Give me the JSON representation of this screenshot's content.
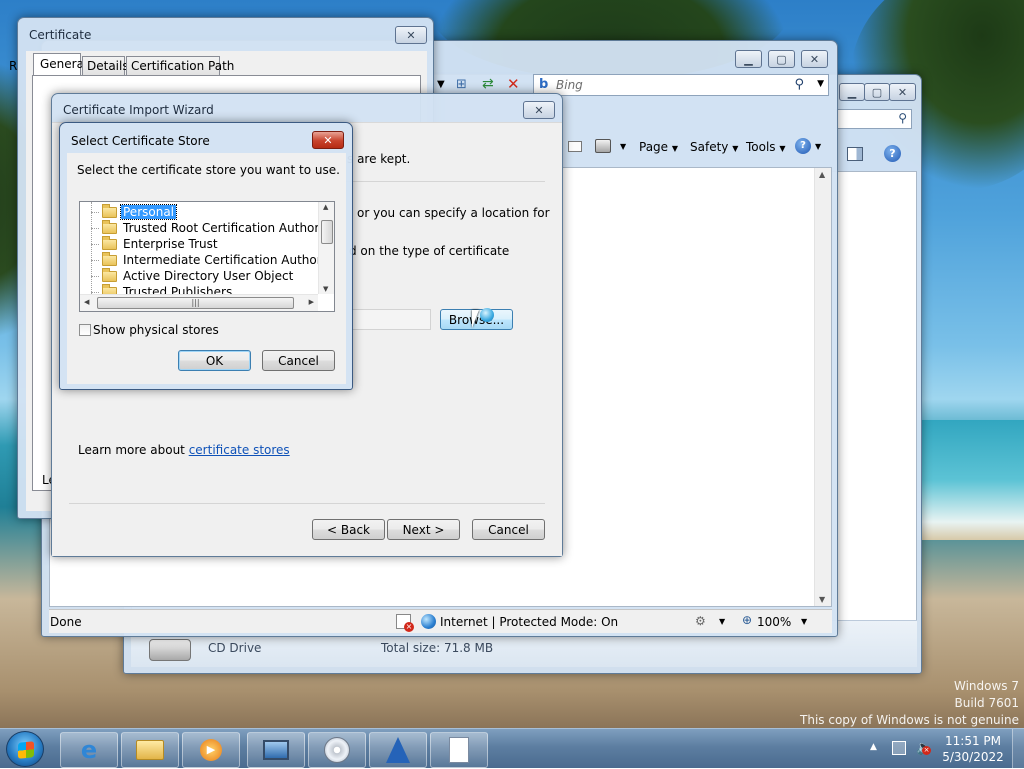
{
  "certificate_window": {
    "title": "Certificate",
    "tabs": [
      "General",
      "Details",
      "Certification Path"
    ],
    "left_fragment_r": "R",
    "left_fragment_le": "Le"
  },
  "ie_window": {
    "search_placeholder": "Bing",
    "toolbar": {
      "page": "Page",
      "safety": "Safety",
      "tools": "Tools"
    },
    "status": {
      "done": "Done",
      "zone": "Internet | Protected Mode: On",
      "zoom": "100%"
    }
  },
  "explorer_window": {
    "drive_name": "CD Drive",
    "total_size": "Total size: 71.8 MB"
  },
  "wizard": {
    "title": "Certificate Import Wizard",
    "line1": "s are kept.",
    "line2": "or you can specify a location for",
    "line3": "d on the type of certificate",
    "browse_label": "Browse...",
    "learn_more": "Learn more about ",
    "learn_more_link": "certificate stores",
    "back_label": "< Back",
    "next_label": "Next >",
    "cancel_label": "Cancel"
  },
  "store_dialog": {
    "title": "Select Certificate Store",
    "prompt": "Select the certificate store you want to use.",
    "stores": [
      "Personal",
      "Trusted Root Certification Authorities",
      "Enterprise Trust",
      "Intermediate Certification Authorities",
      "Active Directory User Object",
      "Trusted Publishers"
    ],
    "selected_index": 0,
    "show_physical": "Show physical stores",
    "ok_label": "OK",
    "cancel_label": "Cancel"
  },
  "watermark": {
    "line1": "Windows 7",
    "line2": "Build 7601",
    "line3": "This copy of Windows is not genuine"
  },
  "clock": {
    "time": "11:51 PM",
    "date": "5/30/2022"
  },
  "colors": {
    "selection": "#3399ff",
    "link": "#0f52b8"
  }
}
